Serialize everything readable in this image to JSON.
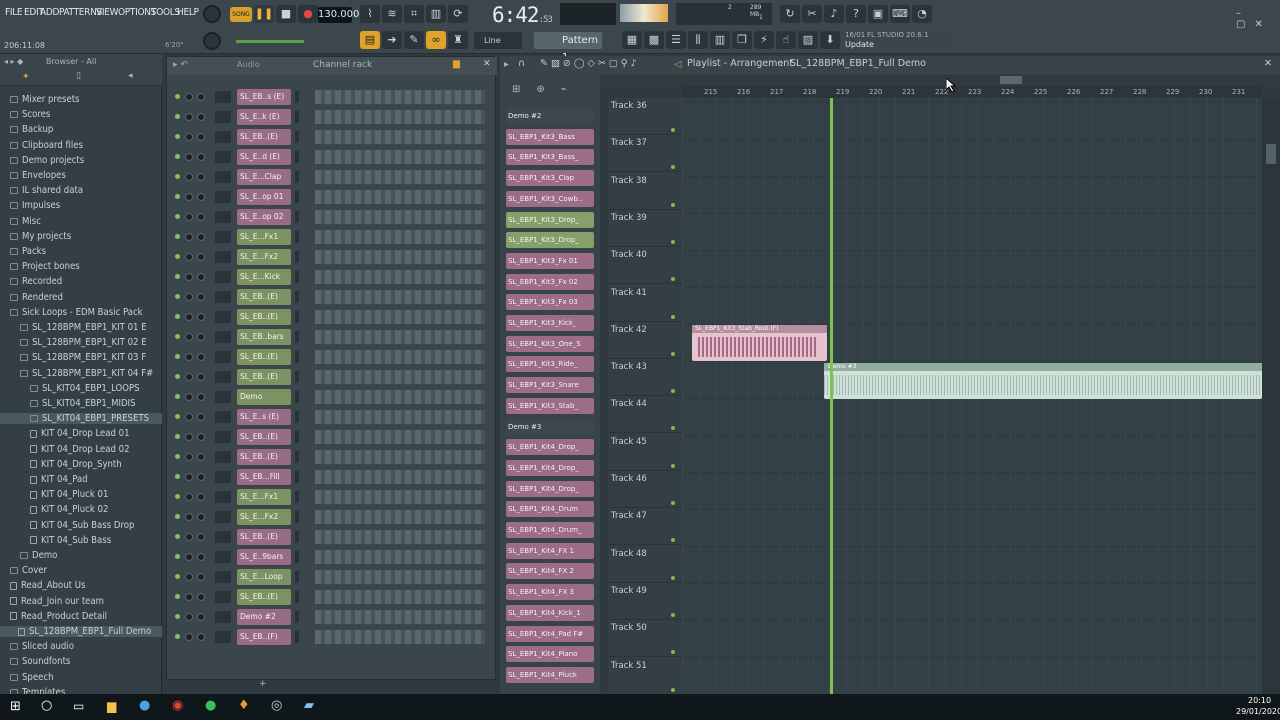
{
  "menu": [
    "FILE",
    "EDIT",
    "ADD",
    "PATTERNS",
    "VIEW",
    "OPTIONS",
    "TOOLS",
    "HELP"
  ],
  "transport": {
    "song": "SONG",
    "bpm": "130.000",
    "time": "6:42",
    "time_small": ":53",
    "mem": "289 MB",
    "mem_sub": "1",
    "cpu": "2"
  },
  "toolbar": {
    "snap": "Line",
    "pattern": "Pattern 1",
    "news_date": "16/01",
    "news_title": "FL STUDIO 20.6.1",
    "news_sub": "Update",
    "hint": "206:11:08",
    "hint2": "6'20\""
  },
  "browser": {
    "title": "Browser - All",
    "items": [
      {
        "label": "Mixer presets",
        "icon": "folder"
      },
      {
        "label": "Scores",
        "icon": "folder"
      },
      {
        "label": "Backup",
        "icon": "folder"
      },
      {
        "label": "Clipboard files",
        "icon": "folder"
      },
      {
        "label": "Demo projects",
        "icon": "folder"
      },
      {
        "label": "Envelopes",
        "icon": "folder"
      },
      {
        "label": "IL shared data",
        "icon": "folder"
      },
      {
        "label": "Impulses",
        "icon": "folder"
      },
      {
        "label": "Misc",
        "icon": "folder"
      },
      {
        "label": "My projects",
        "icon": "folder"
      },
      {
        "label": "Packs",
        "icon": "folder"
      },
      {
        "label": "Project bones",
        "icon": "folder"
      },
      {
        "label": "Recorded",
        "icon": "folder"
      },
      {
        "label": "Rendered",
        "icon": "folder"
      },
      {
        "label": "Sick Loops - EDM Basic Pack",
        "icon": "folder"
      },
      {
        "label": "SL_128BPM_EBP1_KIT 01 E",
        "icon": "folder"
      },
      {
        "label": "SL_128BPM_EBP1_KIT 02 E",
        "icon": "folder"
      },
      {
        "label": "SL_128BPM_EBP1_KIT 03 F",
        "icon": "folder"
      },
      {
        "label": "SL_128BPM_EBP1_KIT 04 F#",
        "icon": "folder"
      },
      {
        "label": "SL_KIT04_EBP1_LOOPS",
        "icon": "folder"
      },
      {
        "label": "SL_KIT04_EBP1_MIDIS",
        "icon": "folder"
      },
      {
        "label": "SL_KIT04_EBP1_PRESETS",
        "icon": "folder"
      },
      {
        "label": "KIT 04_Drop Lead 01",
        "icon": "file"
      },
      {
        "label": "KIT 04_Drop Lead 02",
        "icon": "file"
      },
      {
        "label": "KIT 04_Drop_Synth",
        "icon": "file"
      },
      {
        "label": "KIT 04_Pad",
        "icon": "file"
      },
      {
        "label": "KIT 04_Pluck 01",
        "icon": "file"
      },
      {
        "label": "KIT 04_Pluck 02",
        "icon": "file"
      },
      {
        "label": "KIT 04_Sub Bass Drop",
        "icon": "file"
      },
      {
        "label": "KIT 04_Sub Bass",
        "icon": "file"
      },
      {
        "label": "Demo",
        "icon": "folder"
      },
      {
        "label": "Cover",
        "icon": "folder"
      },
      {
        "label": "Read_About Us",
        "icon": "file"
      },
      {
        "label": "Read_Join our team",
        "icon": "file"
      },
      {
        "label": "Read_Product Detail",
        "icon": "file"
      },
      {
        "label": "SL_128BPM_EBP1_Full Demo",
        "icon": "file"
      },
      {
        "label": "Sliced audio",
        "icon": "folder"
      },
      {
        "label": "Soundfonts",
        "icon": "folder"
      },
      {
        "label": "Speech",
        "icon": "folder"
      },
      {
        "label": "Templates",
        "icon": "folder"
      }
    ]
  },
  "rack": {
    "title": "Channel rack",
    "filter": "Audio",
    "channels": [
      {
        "name": "SL_EB..s (E)",
        "c": "pink"
      },
      {
        "name": "SL_E..k (E)",
        "c": "pink"
      },
      {
        "name": "SL_EB..(E)",
        "c": "pink"
      },
      {
        "name": "SL_E..d (E)",
        "c": "pink"
      },
      {
        "name": "SL_E...Clap",
        "c": "pink"
      },
      {
        "name": "SL_E..op 01",
        "c": "pink"
      },
      {
        "name": "SL_E..op 02",
        "c": "pink"
      },
      {
        "name": "SL_E...Fx1",
        "c": "green"
      },
      {
        "name": "SL_E...Fx2",
        "c": "green"
      },
      {
        "name": "SL_E...Kick",
        "c": "green"
      },
      {
        "name": "SL_EB..(E)",
        "c": "green"
      },
      {
        "name": "SL_EB..(E)",
        "c": "green"
      },
      {
        "name": "SL_EB..bars",
        "c": "green"
      },
      {
        "name": "SL_EB..(E)",
        "c": "green"
      },
      {
        "name": "SL_EB..(E)",
        "c": "green"
      },
      {
        "name": "Demo",
        "c": "green"
      },
      {
        "name": "SL_E..s (E)",
        "c": "pink"
      },
      {
        "name": "SL_EB..(E)",
        "c": "pink"
      },
      {
        "name": "SL_EB..(E)",
        "c": "pink"
      },
      {
        "name": "SL_EB...Fill",
        "c": "pink"
      },
      {
        "name": "SL_E...Fx1",
        "c": "green"
      },
      {
        "name": "SL_E...Fx2",
        "c": "green"
      },
      {
        "name": "SL_EB..(E)",
        "c": "pink"
      },
      {
        "name": "SL_E..9bars",
        "c": "pink"
      },
      {
        "name": "SL_E...Loop",
        "c": "green"
      },
      {
        "name": "SL_EB..(E)",
        "c": "green"
      },
      {
        "name": "Demo #2",
        "c": "pink"
      },
      {
        "name": "SL_EB..(F)",
        "c": "pink"
      }
    ]
  },
  "playlist": {
    "title": "Playlist - Arrangement",
    "crumb": "SL_128BPM_EBP1_Full Demo",
    "ruler": [
      "215",
      "216",
      "217",
      "218",
      "219",
      "220",
      "221",
      "222",
      "223",
      "224",
      "225",
      "226",
      "227",
      "228",
      "229",
      "230",
      "231"
    ],
    "tracks": [
      "Track 36",
      "Track 37",
      "Track 38",
      "Track 39",
      "Track 40",
      "Track 41",
      "Track 42",
      "Track 43",
      "Track 44",
      "Track 45",
      "Track 46",
      "Track 47",
      "Track 48",
      "Track 49",
      "Track 50",
      "Track 51"
    ],
    "picker": [
      {
        "name": "Demo #2",
        "c": "dark"
      },
      {
        "name": "SL_EBP1_Kit3_Bass",
        "c": "pink"
      },
      {
        "name": "SL_EBP1_Kit3_Bass_",
        "c": "pink"
      },
      {
        "name": "SL_EBP1_Kit3_Clap",
        "c": "pink"
      },
      {
        "name": "SL_EBP1_Kit3_Cowb..",
        "c": "pink"
      },
      {
        "name": "SL_EBP1_Kit3_Drop_",
        "c": "green"
      },
      {
        "name": "SL_EBP1_Kit3_Drop_",
        "c": "green"
      },
      {
        "name": "SL_EBP1_Kit3_Fx 01",
        "c": "pink"
      },
      {
        "name": "SL_EBP1_Kit3_Fx 02",
        "c": "pink"
      },
      {
        "name": "SL_EBP1_Kit3_Fx 03",
        "c": "pink"
      },
      {
        "name": "SL_EBP1_Kit3_Kick_",
        "c": "pink"
      },
      {
        "name": "SL_EBP1_Kit3_One_S",
        "c": "pink"
      },
      {
        "name": "SL_EBP1_Kit3_Ride_",
        "c": "pink"
      },
      {
        "name": "SL_EBP1_Kit3_Snare",
        "c": "pink"
      },
      {
        "name": "SL_EBP1_Kit3_Stab_",
        "c": "pink"
      },
      {
        "name": "Demo #3",
        "c": "dark"
      },
      {
        "name": "SL_EBP1_Kit4_Drop_",
        "c": "pink"
      },
      {
        "name": "SL_EBP1_Kit4_Drop_",
        "c": "pink"
      },
      {
        "name": "SL_EBP1_Kit4_Drop_",
        "c": "pink"
      },
      {
        "name": "SL_EBP1_Kit4_Drum",
        "c": "pink"
      },
      {
        "name": "SL_EBP1_Kit4_Drum_",
        "c": "pink"
      },
      {
        "name": "SL_EBP1_Kit4_FX 1",
        "c": "pink"
      },
      {
        "name": "SL_EBP1_Kit4_FX 2",
        "c": "pink"
      },
      {
        "name": "SL_EBP1_Kit4_FX 3",
        "c": "pink"
      },
      {
        "name": "SL_EBP1_Kit4_Kick_1",
        "c": "pink"
      },
      {
        "name": "SL_EBP1_Kit4_Pad F#",
        "c": "pink"
      },
      {
        "name": "SL_EBP1_Kit4_Piano",
        "c": "pink"
      },
      {
        "name": "SL_EBP1_Kit4_Pluck",
        "c": "pink"
      }
    ],
    "clip1": "SL_EBP1_Kit3_Stab_Root (F)",
    "clip2": "Demo #3"
  },
  "taskbar": {
    "time": "20:10",
    "date": "29/01/2020"
  },
  "colors": {
    "accent": "#f0a030",
    "playhead": "#7cc44e"
  }
}
